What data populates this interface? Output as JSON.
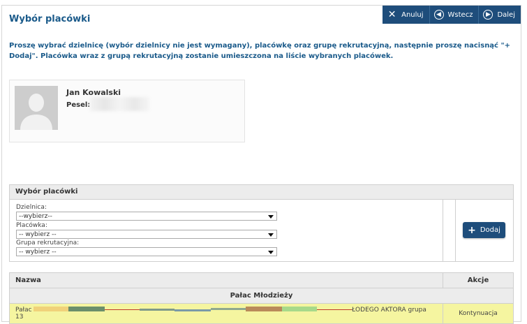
{
  "header": {
    "title": "Wybór placówki",
    "buttons": [
      {
        "label": "Anuluj",
        "icon": "close-icon"
      },
      {
        "label": "Wstecz",
        "icon": "back-circle-icon"
      },
      {
        "label": "Dalej",
        "icon": "forward-circle-icon"
      }
    ]
  },
  "instructions": "Proszę wybrać dzielnicę (wybór dzielnicy nie jest wymagany), placówkę oraz grupę rekrutacyjną, następnie proszę nacisnąć \"+ Dodaj\". Placówka wraz z grupą rekrutacyjną zostanie umieszczona na liście wybranych placówek.",
  "person": {
    "name": "Jan Kowalski",
    "pesel_label": "Pesel:"
  },
  "selection": {
    "header": "Wybór placówki",
    "fields": [
      {
        "label": "Dzielnica:",
        "value": "--wybierz--"
      },
      {
        "label": "Placówka:",
        "value": "-- wybierz --"
      },
      {
        "label": "Grupa rekrutacyjna:",
        "value": "-- wybierz --"
      }
    ],
    "add_label": "Dodaj"
  },
  "table": {
    "col_name": "Nazwa",
    "col_actions": "Akcje",
    "group": "Pałac Młodzieży",
    "row": {
      "name_start": "Pałac",
      "name_line2": "13",
      "name_end": "ŁODEGO AKTORA grupa",
      "action": "Kontynuacja"
    }
  },
  "colors": {
    "primary": "#1e4d7b",
    "title": "#1a5a8a",
    "row_highlight": "#f5f5a0"
  }
}
